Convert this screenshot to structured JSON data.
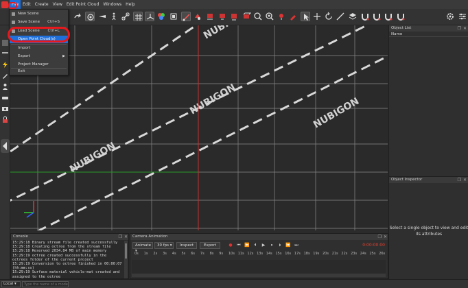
{
  "menubar": {
    "items": [
      "File",
      "Edit",
      "Create",
      "View",
      "Edit Point Cloud",
      "Windows",
      "Help"
    ]
  },
  "file_menu": {
    "items": [
      {
        "label": "New Scene",
        "shortcut": ""
      },
      {
        "label": "Save Scene",
        "shortcut": "Ctrl+S"
      },
      {
        "label": "Load Scene",
        "shortcut": "Ctrl+L"
      },
      {
        "label": "Open Point Cloud(s)",
        "shortcut": ""
      },
      {
        "label": "Import",
        "shortcut": ""
      },
      {
        "label": "Export",
        "shortcut": ""
      },
      {
        "label": "Project Manager",
        "shortcut": ""
      },
      {
        "label": "Exit",
        "shortcut": ""
      }
    ]
  },
  "viewport": {
    "watermark": "NUBIGON",
    "colors": {
      "x_axis": "#c03030",
      "z_axis": "#2a9a2a",
      "grid": "#8a8a8a"
    }
  },
  "object_list": {
    "title": "Object List",
    "column": "Name"
  },
  "inspector": {
    "title": "Object Inspector",
    "message": "Select a single object to view and edit its attributes"
  },
  "console": {
    "title": "Console",
    "log": "15:29:18 Binary stream file created successfully\n15:29:18 Creating octree from the stream file\n15:29:18 Reserved 2034.84 MB of main memory\n15:29:19 octree created successfully in the\noctrees folder of the current project\n15:29:19 Conversion to octree finished in 00:00:07\n(hh:mm:ss)\n15:29:19 Surface material vehicle-mat created and\nassigned to the octree"
  },
  "camera": {
    "title": "Camera Animation",
    "mode": "Animate",
    "fps": "30 fps",
    "inspect_label": "Inspect",
    "export_label": "Export",
    "time": "0:00:00:00",
    "ticks": [
      "0s",
      "1s",
      "2s",
      "3s",
      "4s",
      "5s",
      "6s",
      "7s",
      "8s",
      "9s",
      "10s",
      "11s",
      "12s",
      "13s",
      "14s",
      "15s",
      "16s",
      "17s",
      "18s",
      "19s",
      "20s",
      "21s",
      "22s",
      "23s",
      "24s",
      "25s",
      "26s"
    ]
  },
  "statusbar": {
    "mode": "Local",
    "placeholder": "Type the name of a model"
  },
  "accent": "#1e6fd9",
  "annotation_color": "#e8181c"
}
